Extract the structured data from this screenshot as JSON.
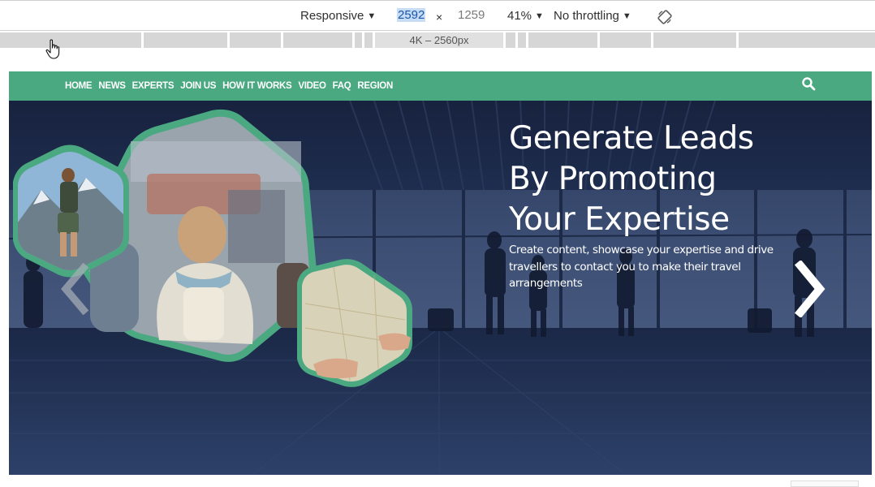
{
  "devtools": {
    "device_mode": "Responsive",
    "width_value": "2592",
    "height_value": "1259",
    "times": "×",
    "zoom": "41%",
    "throttling": "No throttling",
    "caret": "▼",
    "ruler_label": "4K – 2560px"
  },
  "site": {
    "nav": {
      "items": [
        "HOME",
        "NEWS",
        "EXPERTS",
        "JOIN US",
        "HOW IT WORKS",
        "VIDEO",
        "FAQ",
        "REGION"
      ]
    },
    "hero": {
      "headline_lines": [
        "Generate Leads",
        "By Promoting",
        "Your Expertise"
      ],
      "subtext": "Create content, showcase your expertise and drive travellers to contact you to make their travel arrangements"
    }
  },
  "colors": {
    "nav_green": "#4aa981",
    "hex_border": "#4aa981",
    "hero_navy": "#1f2e52"
  },
  "icons": {
    "search": "search-icon",
    "rotate": "rotate-icon",
    "prev": "chevron-left-icon",
    "next": "chevron-right-icon",
    "cursor": "hand-cursor-icon"
  }
}
